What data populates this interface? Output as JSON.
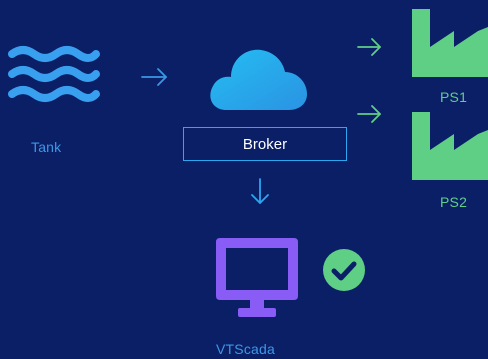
{
  "nodes": {
    "tank": {
      "label": "Tank",
      "icon": "water-waves-icon"
    },
    "broker": {
      "label": "Broker",
      "icon": "cloud-icon"
    },
    "ps1": {
      "label": "PS1",
      "icon": "factory-icon"
    },
    "ps2": {
      "label": "PS2",
      "icon": "factory-icon"
    },
    "vtscada": {
      "label": "VTScada",
      "icon": "monitor-icon",
      "status_icon": "check-circle-icon"
    }
  },
  "colors": {
    "background": "#0b1f66",
    "blue_accent": "#3b97e6",
    "cyan_accent": "#2aa7f0",
    "green_accent": "#5fcf86",
    "purple_accent": "#8a5cf6",
    "white": "#ffffff"
  }
}
